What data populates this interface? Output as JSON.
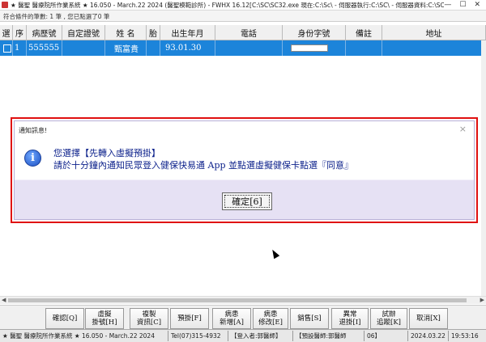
{
  "window": {
    "title": "★ 醫聖 醫療院所作業系統 ★ 16.050 - March.22 2024 (醫聖模範診所) - FWHX 16.12[C:\\SC\\SC32.exe 現在:C:\\Sc\\ - 伺服器執行:C:\\SC\\ - 伺服器資料:C:\\SC\\DAT\\ - D...",
    "min": "—",
    "max": "☐",
    "close": "✕"
  },
  "infobar": "符合條件的筆數: 1 筆 , 您已點選了0 筆",
  "grid": {
    "headers": [
      "選",
      "序",
      "病歷號",
      "自定證號",
      "姓 名",
      "胎",
      "出生年月",
      "電話",
      "身份字號",
      "備註",
      "地址"
    ],
    "row": {
      "seq": "1",
      "chart_no": "555555",
      "custom_id": "",
      "name": "甄富貴",
      "birth": "93.01.30"
    }
  },
  "dialog": {
    "title": "通知訊息!",
    "close": "×",
    "icon": "info-icon",
    "line1": "您選擇【先轉入虛擬預掛】",
    "line2": "請於十分鐘內通知民眾登入健保快易通 App 並點選虛擬健保卡點選『同意』",
    "ok": "確定[6]"
  },
  "toolbar": {
    "confirm": "確認[Q]",
    "virtual": "虛擬\n掛號[H]",
    "copy": "複製\n資訊[C]",
    "prereg": "預掛[F]",
    "newcase": "病患\n新增[A]",
    "editcase": "病患\n修改[E]",
    "sales": "銷售[S]",
    "abnormal": "異常\n退掛[I]",
    "trial": "試辦\n追蹤[K]",
    "cancel": "取消[X]"
  },
  "statusbar": {
    "app": "★ 醫聖 醫療院所作業系統 ★ 16.050 - March.22 2024",
    "tel": "Tel(07)315-4932",
    "login": "【登入者:郭醫師】",
    "doctor": "【預設醫師:郭醫師",
    "num": "06】",
    "date": "2024.03.22",
    "time": "19:53:16"
  }
}
